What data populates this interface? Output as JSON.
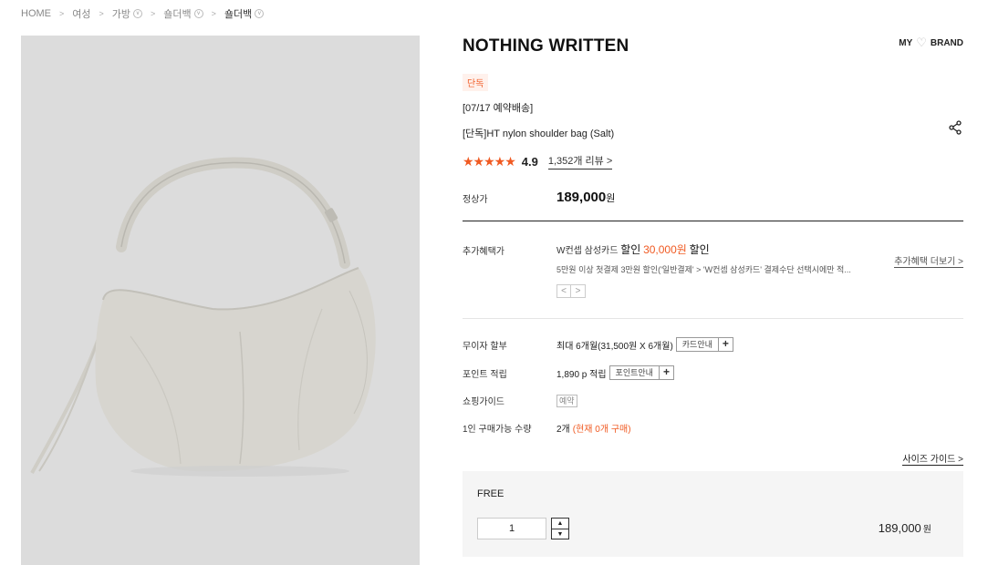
{
  "breadcrumb": [
    {
      "label": "HOME",
      "dropdown": false
    },
    {
      "label": "여성",
      "dropdown": false
    },
    {
      "label": "가방",
      "dropdown": true
    },
    {
      "label": "숄더백",
      "dropdown": true
    },
    {
      "label": "숄더백",
      "dropdown": true
    }
  ],
  "product": {
    "brand": "NOTHING WRITTEN",
    "badge": "단독",
    "shipping": "[07/17 예약배송]",
    "name": "[단독]HT nylon shoulder bag (Salt)",
    "rating": "4.9",
    "stars": "★★★★★",
    "review_count": "1,352개 리뷰",
    "review_arrow": ">"
  },
  "header_links": {
    "my": "MY",
    "brand": "BRAND"
  },
  "price": {
    "label": "정상가",
    "value": "189,000",
    "unit": "원"
  },
  "benefit": {
    "label": "추가혜택가",
    "card": "W컨셉 삼성카드",
    "discount_word": "할인",
    "amount": "30,000원",
    "discount_word2": "할인",
    "desc": "5만원 이상 첫결제 3만원 할인('일반결제' > 'W컨셉 삼성카드' 결제수단 선택시에만 적...",
    "more": "추가혜택 더보기 >",
    "prev": "<",
    "next": ">"
  },
  "installment": {
    "label": "무이자 할부",
    "value": "최대 6개월(31,500원 X 6개월)",
    "button": "카드안내",
    "plus": "+"
  },
  "points": {
    "label": "포인트 적립",
    "value": "1,890 p 적립",
    "button": "포인트안내",
    "plus": "+"
  },
  "guide": {
    "label": "쇼핑가이드",
    "tag": "예약"
  },
  "limit": {
    "label": "1인 구매가능 수량",
    "value": "2개",
    "current": "(현재 0개 구매)"
  },
  "size_guide": "사이즈 가이드 >",
  "option": {
    "name": "FREE",
    "quantity": "1",
    "price": "189,000",
    "unit": "원",
    "up": "▲",
    "down": "▼"
  },
  "colors": {
    "accent": "#f05a22",
    "image_bg": "#dcdcdc",
    "bag": "#d7d5cf"
  }
}
